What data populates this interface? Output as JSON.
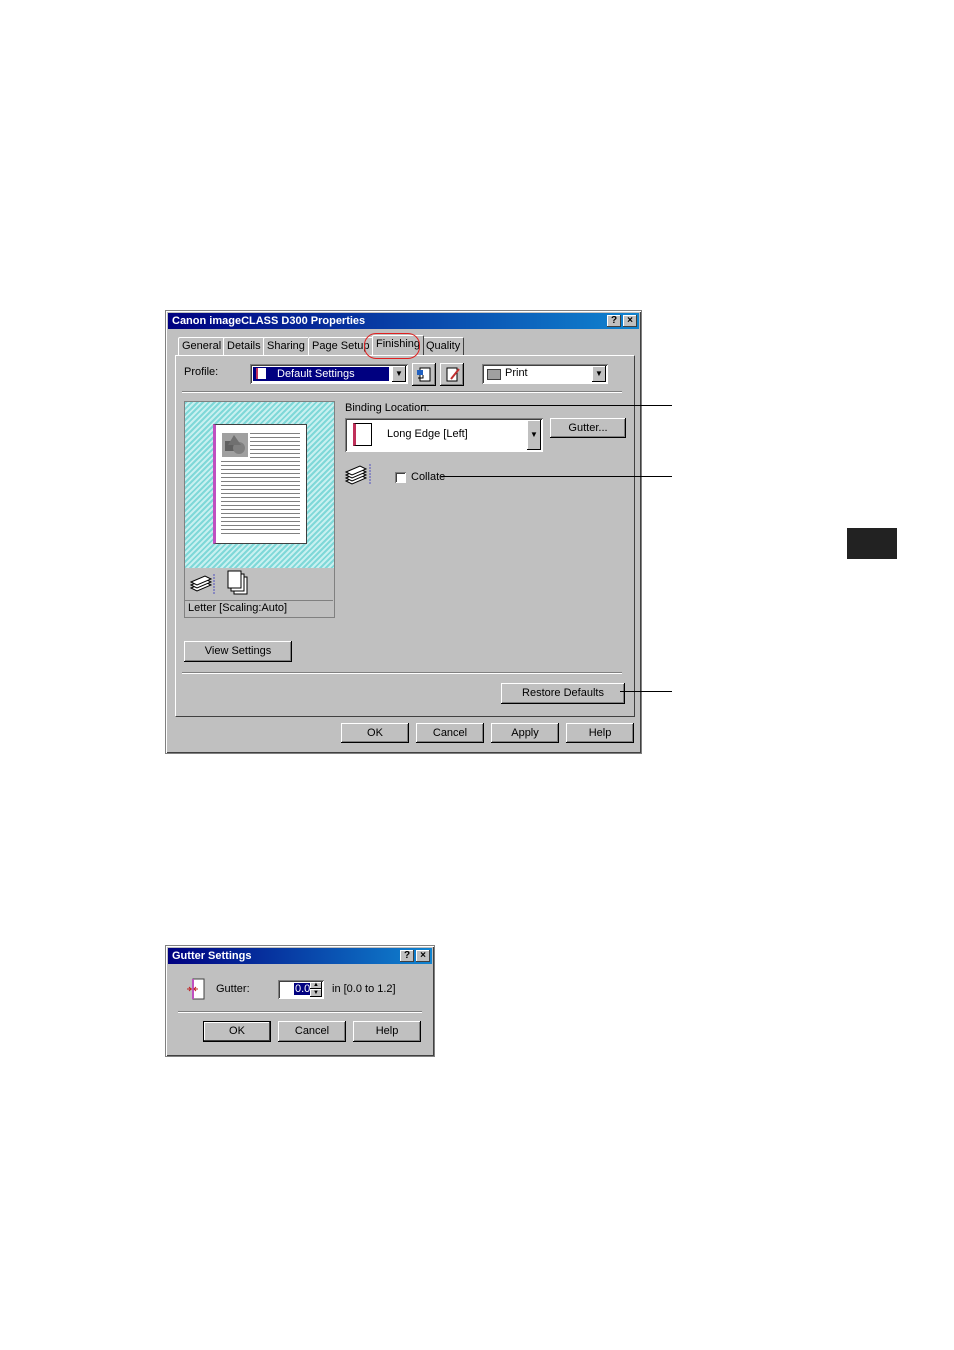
{
  "properties_dialog": {
    "title": "Canon imageCLASS D300 Properties",
    "help_button": "?",
    "close_button": "×",
    "tabs": [
      "General",
      "Details",
      "Sharing",
      "Page Setup",
      "Finishing",
      "Quality"
    ],
    "active_tab": "Finishing",
    "profile_label": "Profile:",
    "profile_value": "Default Settings",
    "output_value": "Print",
    "binding_location_label": "Binding Location:",
    "binding_value": "Long Edge [Left]",
    "gutter_button": "Gutter...",
    "collate_label": "Collate",
    "collate_checked": false,
    "preview_caption": "Letter [Scaling:Auto]",
    "view_settings_button": "View Settings",
    "restore_defaults_button": "Restore Defaults",
    "ok_button": "OK",
    "cancel_button": "Cancel",
    "apply_button": "Apply",
    "help_bottom_button": "Help"
  },
  "gutter_dialog": {
    "title": "Gutter Settings",
    "help_button": "?",
    "close_button": "×",
    "gutter_label": "Gutter:",
    "gutter_value": "0.0",
    "range_text": "in [0.0 to 1.2]",
    "ok_button": "OK",
    "cancel_button": "Cancel",
    "help_bottom_button": "Help"
  },
  "colors": {
    "title_start": "#000080",
    "title_end": "#1084d0",
    "highlight_circle": "#e02020",
    "preview_bg": "#7fd8d8",
    "side_tab": "#222222"
  }
}
